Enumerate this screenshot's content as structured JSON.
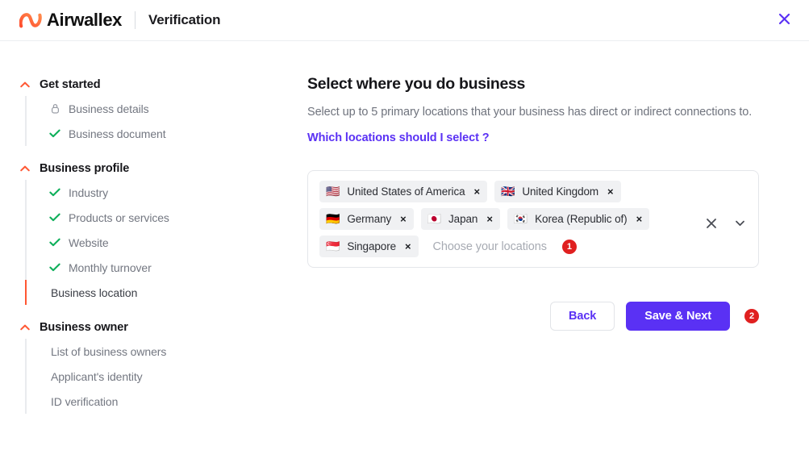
{
  "header": {
    "logo_text": "Airwallex",
    "logo_icon": "airwallex-logo-icon",
    "subtitle": "Verification",
    "close_icon": "close-icon",
    "brand_color": "#ff5733",
    "accent_color": "#5a31f4"
  },
  "sidebar": {
    "sections": [
      {
        "title": "Get started",
        "chevron_icon": "chevron-up-icon",
        "items": [
          {
            "label": "Business details",
            "icon": "lock-icon",
            "state": "locked"
          },
          {
            "label": "Business document",
            "icon": "check-icon",
            "state": "complete"
          }
        ]
      },
      {
        "title": "Business profile",
        "chevron_icon": "chevron-up-icon",
        "items": [
          {
            "label": "Industry",
            "icon": "check-icon",
            "state": "complete"
          },
          {
            "label": "Products or services",
            "icon": "check-icon",
            "state": "complete"
          },
          {
            "label": "Website",
            "icon": "check-icon",
            "state": "complete"
          },
          {
            "label": "Monthly turnover",
            "icon": "check-icon",
            "state": "complete"
          },
          {
            "label": "Business location",
            "icon": "none",
            "state": "active"
          }
        ]
      },
      {
        "title": "Business owner",
        "chevron_icon": "chevron-up-icon",
        "items": [
          {
            "label": "List of business owners",
            "icon": "none",
            "state": "pending"
          },
          {
            "label": "Applicant's identity",
            "icon": "none",
            "state": "pending"
          },
          {
            "label": "ID verification",
            "icon": "none",
            "state": "pending"
          }
        ]
      }
    ]
  },
  "main": {
    "title": "Select where you do business",
    "subtitle": "Select up to 5 primary locations that your business has direct or indirect connections to.",
    "help_link": "Which locations should I select ?",
    "multiselect": {
      "placeholder": "Choose your locations",
      "annotation_badge": "1",
      "clear_icon": "close-icon",
      "dropdown_icon": "chevron-down-icon",
      "remove_icon": "×",
      "selected": [
        {
          "label": "United States of America",
          "flag": "🇺🇸"
        },
        {
          "label": "United Kingdom",
          "flag": "🇬🇧"
        },
        {
          "label": "Germany",
          "flag": "🇩🇪"
        },
        {
          "label": "Japan",
          "flag": "🇯🇵"
        },
        {
          "label": "Korea (Republic of)",
          "flag": "🇰🇷"
        },
        {
          "label": "Singapore",
          "flag": "🇸🇬"
        }
      ]
    },
    "actions": {
      "back_label": "Back",
      "next_label": "Save & Next",
      "annotation_badge": "2"
    }
  }
}
